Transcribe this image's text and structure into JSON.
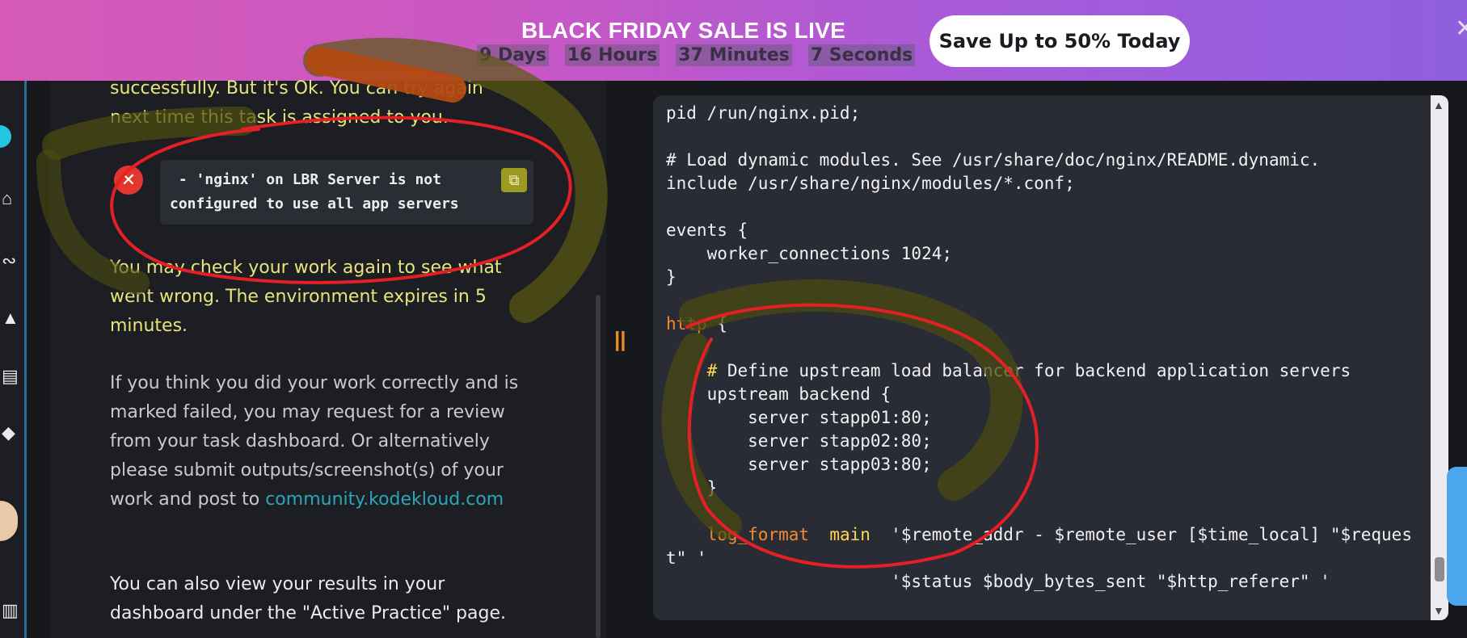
{
  "banner": {
    "title": "BLACK FRIDAY SALE IS LIVE",
    "countdown": [
      "9 Days",
      "16 Hours",
      "37 Minutes",
      "7 Seconds"
    ],
    "cta": "Save Up to 50% Today",
    "close_icon": "close-icon"
  },
  "rail": {
    "icons": [
      "home-icon",
      "route-icon",
      "chart-icon",
      "calendar-icon",
      "puzzle-icon",
      "book-icon"
    ]
  },
  "left_panel": {
    "intro_line1": "successfully. But it's Ok. You can try again",
    "intro_line2": "next time this task is assigned to you.",
    "error_text": " - 'nginx' on LBR Server is not\nconfigured to use all app servers",
    "recheck_line1": "You may check your work again to see what",
    "recheck_line2": "went wrong. The environment expires in 5",
    "recheck_line3": "minutes.",
    "review_line1": "If you think you did your work correctly and is",
    "review_line2": "marked failed, you may request for a review",
    "review_line3": "from your task dashboard. Or alternatively",
    "review_line4": "please submit outputs/screenshot(s) of your",
    "review_line5": "work and post to ",
    "review_link": "community.kodekloud.com",
    "results_line1": "You can also view your results in your",
    "results_line2": "dashboard under the \"Active Practice\" page."
  },
  "editor": {
    "lines": [
      "pid /run/nginx.pid;",
      "",
      "# Load dynamic modules. See /usr/share/doc/nginx/README.dynamic.",
      "include /usr/share/nginx/modules/*.conf;",
      "",
      "events {",
      "    worker_connections 1024;",
      "}",
      "",
      "http {",
      "",
      "    # Define upstream load balancer for backend application servers",
      "    upstream backend {",
      "        server stapp01:80;",
      "        server stapp02:80;",
      "        server stapp03:80;",
      "    }",
      "",
      "    log_format  main  '$remote_addr - $remote_user [$time_local] \"$reques",
      "t\" '",
      "                      '$status $body_bytes_sent \"$http_referer\" '"
    ]
  },
  "colors": {
    "banner_start": "#d55ab7",
    "banner_end": "#8f5fe0",
    "editor_bg": "#2a2c35",
    "error_red": "#e2372e",
    "highlight_yellow": "#e6e47a",
    "link_teal": "#2aa6b8",
    "annotation_red": "#e41f26"
  }
}
